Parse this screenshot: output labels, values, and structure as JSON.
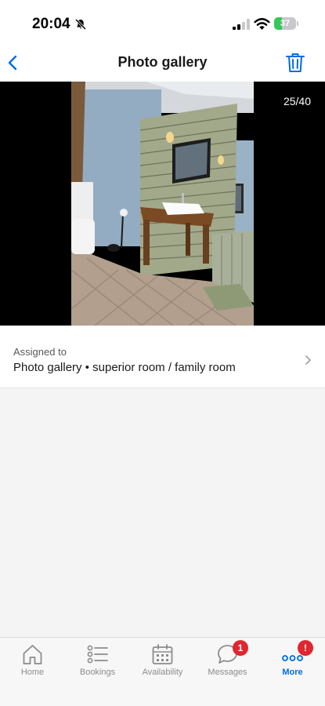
{
  "status_bar": {
    "time": "20:04",
    "battery_level": "37",
    "battery_fraction": 0.37,
    "battery_color": "#34c759"
  },
  "nav": {
    "title": "Photo gallery",
    "back_icon": "chevron-left-icon",
    "delete_icon": "trash-icon",
    "accent_color": "#006ce4"
  },
  "photo_viewer": {
    "counter": "25/40"
  },
  "assigned": {
    "label": "Assigned to",
    "value": "Photo gallery • superior room / family room"
  },
  "tab_bar": {
    "tabs": [
      {
        "label": "Home",
        "icon": "home-icon",
        "active": false
      },
      {
        "label": "Bookings",
        "icon": "list-icon",
        "active": false
      },
      {
        "label": "Availability",
        "icon": "calendar-icon",
        "active": false
      },
      {
        "label": "Messages",
        "icon": "chat-icon",
        "active": false,
        "badge": "1"
      },
      {
        "label": "More",
        "icon": "more-icon",
        "active": true,
        "badge": "!"
      }
    ]
  }
}
